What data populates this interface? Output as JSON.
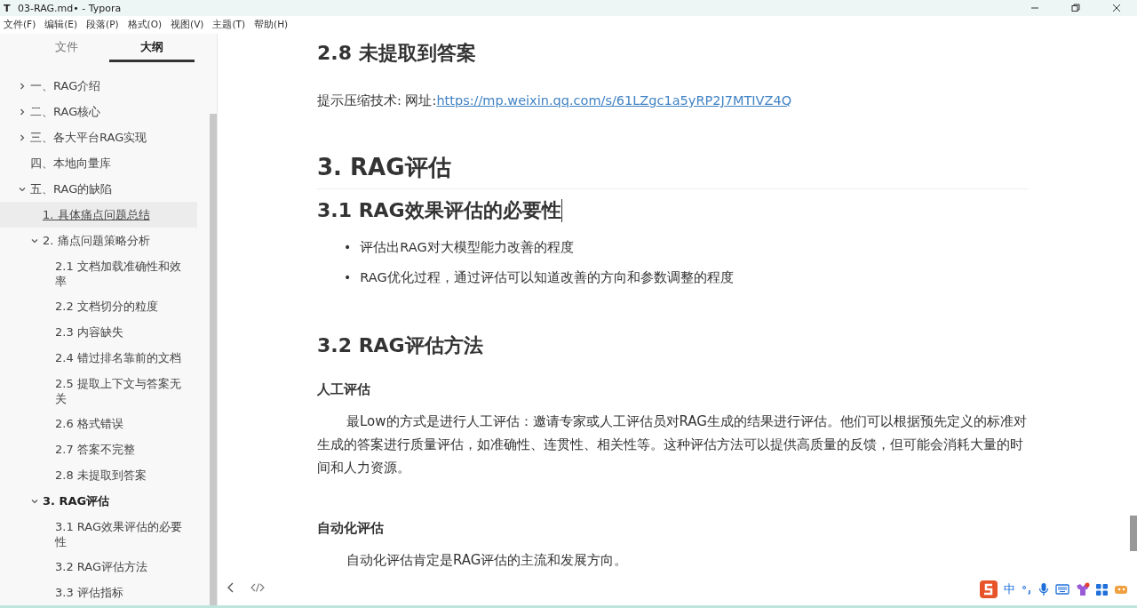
{
  "window": {
    "title": "03-RAG.md• - Typora",
    "app_letter": "T"
  },
  "menu": [
    "文件(F)",
    "编辑(E)",
    "段落(P)",
    "格式(O)",
    "视图(V)",
    "主题(T)",
    "帮助(H)"
  ],
  "tabs": [
    {
      "label": "文件",
      "selected": false
    },
    {
      "label": "大纲",
      "selected": true
    }
  ],
  "outline": [
    {
      "label": "一、RAG介绍",
      "expanded": false,
      "selected": false,
      "current": false
    },
    {
      "label": "二、RAG核心",
      "expanded": false,
      "selected": false,
      "current": false
    },
    {
      "label": "三、各大平台RAG实现",
      "expanded": false,
      "selected": false,
      "current": false
    },
    {
      "label": "四、本地向量库",
      "selected": false,
      "current": false
    },
    {
      "label": "五、RAG的缺陷",
      "expanded": true,
      "selected": false,
      "current": false,
      "children": [
        {
          "label": "1. 具体痛点问题总结",
          "selected": true,
          "current": false
        },
        {
          "label": "2. 痛点问题策略分析",
          "expanded": true,
          "selected": false,
          "current": false,
          "children": [
            {
              "label": "2.1 文档加载准确性和效率",
              "selected": false,
              "current": false
            },
            {
              "label": "2.2 文档切分的粒度",
              "selected": false,
              "current": false
            },
            {
              "label": "2.3 内容缺失",
              "selected": false,
              "current": false
            },
            {
              "label": "2.4 错过排名靠前的文档",
              "selected": false,
              "current": false
            },
            {
              "label": "2.5 提取上下文与答案无关",
              "selected": false,
              "current": false
            },
            {
              "label": "2.6 格式错误",
              "selected": false,
              "current": false
            },
            {
              "label": "2.7 答案不完整",
              "selected": false,
              "current": false
            },
            {
              "label": "2.8 未提取到答案",
              "selected": false,
              "current": false
            }
          ]
        },
        {
          "label": "3. RAG评估",
          "expanded": true,
          "selected": false,
          "current": true,
          "children": [
            {
              "label": "3.1 RAG效果评估的必要性",
              "selected": false,
              "current": false
            },
            {
              "label": "3.2 RAG评估方法",
              "selected": false,
              "current": false
            },
            {
              "label": "3.3 评估指标",
              "selected": false,
              "current": false
            }
          ]
        }
      ]
    }
  ],
  "document": [
    {
      "kind": "h2",
      "text": "2.8 未提取到答案"
    },
    {
      "kind": "link_paragraph",
      "text": "提示压缩技术: 网址:",
      "link": "https://mp.weixin.qq.com/s/61LZgc1a5yRP2J7MTIVZ4Q"
    },
    {
      "kind": "h1",
      "text": "3. RAG评估"
    },
    {
      "kind": "h2",
      "text": "3.1 RAG效果评估的必要性",
      "cursor": true
    },
    {
      "kind": "bullets",
      "marker": "•",
      "items": [
        "评估出RAG对大模型能力改善的程度",
        "RAG优化过程，通过评估可以知道改善的方向和参数调整的程度"
      ]
    },
    {
      "kind": "h2",
      "text": "3.2 RAG评估方法"
    },
    {
      "kind": "h4",
      "text": "人工评估"
    },
    {
      "kind": "paragraph",
      "text": "最Low的方式是进行人工评估：邀请专家或人工评估员对RAG生成的结果进行评估。他们可以根据预先定义的标准对生成的答案进行质量评估，如准确性、连贯性、相关性等。这种评估方法可以提供高质量的反馈，但可能会消耗大量的时间和人力资源。"
    },
    {
      "kind": "h4",
      "text": "自动化评估"
    },
    {
      "kind": "paragraph",
      "text": "自动化评估肯定是RAG评估的主流和发展方向。"
    }
  ],
  "ime": {
    "mode": "中"
  }
}
